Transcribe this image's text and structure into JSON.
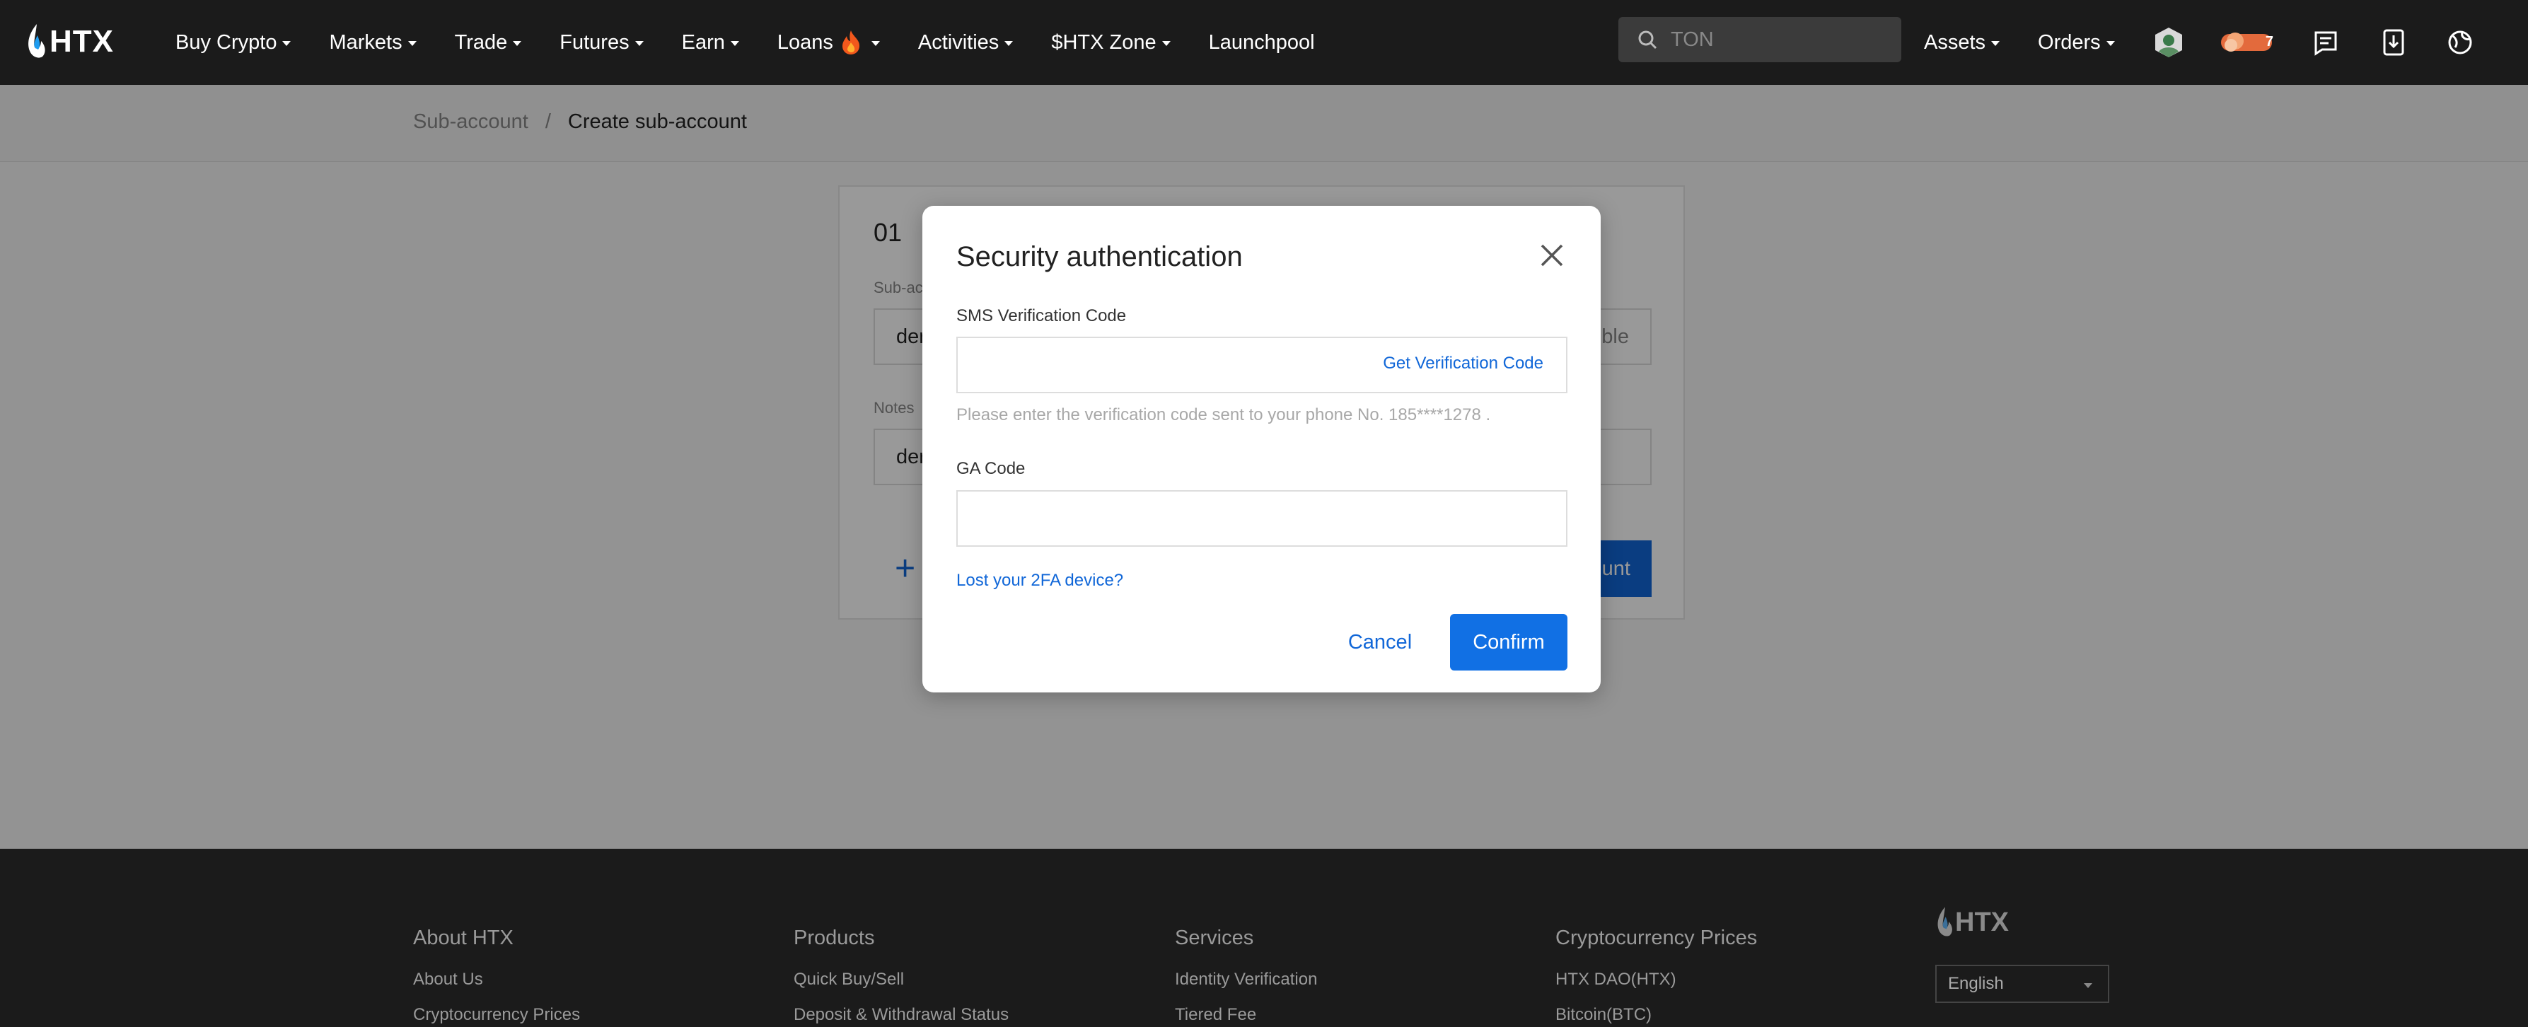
{
  "nav": {
    "logo_text": "HTX",
    "items": [
      {
        "label": "Buy Crypto",
        "caret": true
      },
      {
        "label": "Markets",
        "caret": true
      },
      {
        "label": "Trade",
        "caret": true
      },
      {
        "label": "Futures",
        "caret": true
      },
      {
        "label": "Earn",
        "caret": true
      },
      {
        "label": "Loans",
        "caret": true,
        "flame": true
      },
      {
        "label": "Activities",
        "caret": true
      },
      {
        "label": "$HTX Zone",
        "caret": true
      },
      {
        "label": "Launchpool",
        "caret": false
      }
    ],
    "search_placeholder": "TON",
    "assets_label": "Assets",
    "orders_label": "Orders",
    "rewards_count": "7",
    "icons": [
      "search-icon",
      "avatar-icon",
      "rewards-icon",
      "messages-icon",
      "download-icon",
      "language-icon"
    ]
  },
  "breadcrumb": {
    "parent": "Sub-account",
    "separator": "/",
    "current": "Create sub-account"
  },
  "card": {
    "title": "01",
    "label1": "Sub-ac",
    "field1_value": "der",
    "field1_right": "ble",
    "label2": "Notes",
    "field2_value": "der",
    "plus": "+",
    "submit_partial": "unt"
  },
  "modal": {
    "title": "Security authentication",
    "sms_label": "SMS Verification Code",
    "get_code": "Get Verification Code",
    "sms_hint": "Please enter the verification code sent to your phone No. 185****1278 .",
    "ga_label": "GA Code",
    "lost_link": "Lost your 2FA device?",
    "cancel": "Cancel",
    "confirm": "Confirm"
  },
  "footer": {
    "columns": [
      {
        "title": "About HTX",
        "links": [
          "About Us",
          "Cryptocurrency Prices"
        ]
      },
      {
        "title": "Products",
        "links": [
          "Quick Buy/Sell",
          "Deposit & Withdrawal Status"
        ]
      },
      {
        "title": "Services",
        "links": [
          "Identity Verification",
          "Tiered Fee"
        ]
      },
      {
        "title": "Cryptocurrency Prices",
        "links": [
          "HTX DAO(HTX)",
          "Bitcoin(BTC)"
        ]
      }
    ],
    "logo_text": "HTX",
    "language": "English"
  },
  "colors": {
    "brand_blue": "#1167d8",
    "nav_bg": "#1b1b1b",
    "footer_bg": "#1b1b1b"
  }
}
